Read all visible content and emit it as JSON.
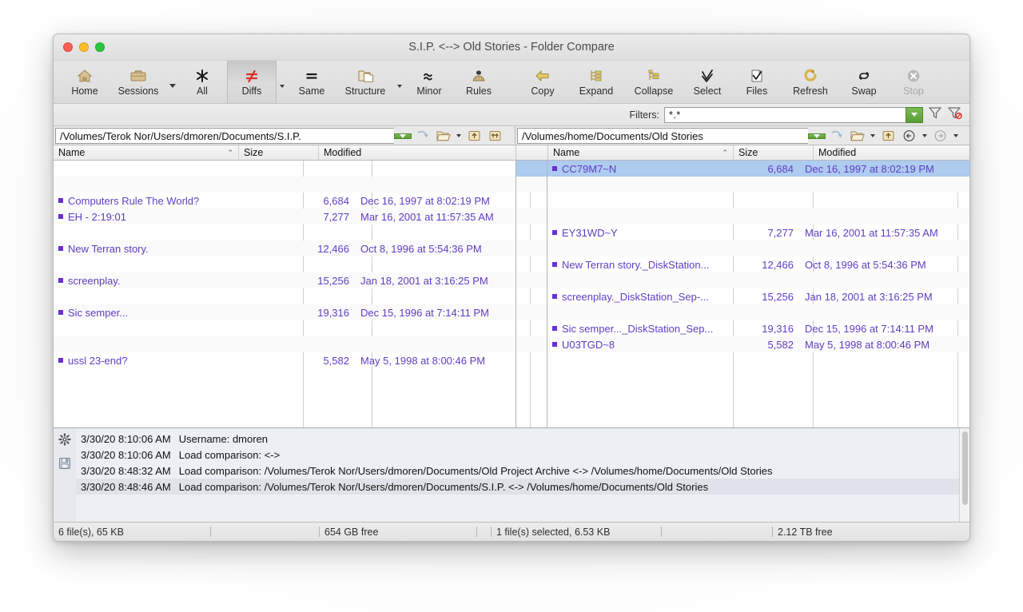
{
  "window": {
    "title": "S.I.P. <--> Old Stories - Folder Compare",
    "traffic": {
      "close": "close-button",
      "minimize": "minimize-button",
      "zoom": "zoom-button"
    }
  },
  "toolbar": {
    "buttons": [
      {
        "label": "Home",
        "icon": "home-icon",
        "state": "normal",
        "caret": false
      },
      {
        "label": "Sessions",
        "icon": "briefcase-icon",
        "state": "normal",
        "caret": true
      },
      {
        "label": "All",
        "icon": "asterisk-icon",
        "state": "normal",
        "caret": false
      },
      {
        "label": "Diffs",
        "icon": "not-equal-icon",
        "state": "active",
        "caret": true
      },
      {
        "label": "Same",
        "icon": "equals-icon",
        "state": "normal",
        "caret": false
      },
      {
        "label": "Structure",
        "icon": "folders-icon",
        "state": "active",
        "caret": true
      },
      {
        "label": "Minor",
        "icon": "approx-icon",
        "state": "normal",
        "caret": false
      },
      {
        "label": "Rules",
        "icon": "rules-icon",
        "state": "normal",
        "caret": false
      },
      {
        "label": "Copy",
        "icon": "arrow-left-icon",
        "state": "normal",
        "caret": false
      },
      {
        "label": "Expand",
        "icon": "expand-icon",
        "state": "normal",
        "caret": false
      },
      {
        "label": "Collapse",
        "icon": "collapse-icon",
        "state": "normal",
        "caret": false
      },
      {
        "label": "Select",
        "icon": "checkmarks-icon",
        "state": "normal",
        "caret": false
      },
      {
        "label": "Files",
        "icon": "file-check-icon",
        "state": "normal",
        "caret": false
      },
      {
        "label": "Refresh",
        "icon": "refresh-icon",
        "state": "normal",
        "caret": false
      },
      {
        "label": "Swap",
        "icon": "swap-icon",
        "state": "normal",
        "caret": false
      },
      {
        "label": "Stop",
        "icon": "stop-icon",
        "state": "disabled",
        "caret": false
      }
    ]
  },
  "filterbar": {
    "label": "Filters:",
    "value": "*.*",
    "placeholder": "",
    "dropdown": "chevron-down-icon",
    "funnel": "filter-icon",
    "funnel_clear": "filter-clear-icon"
  },
  "left_pane": {
    "path": "/Volumes/Terok Nor/Users/dmoren/Documents/S.I.P.",
    "columns": [
      "Name",
      "Size",
      "Modified"
    ],
    "sort_indicator": "⌃",
    "rows": [
      {
        "name": "",
        "size": "",
        "modified": "",
        "blank": true,
        "selected": false
      },
      {
        "name": "",
        "size": "",
        "modified": "",
        "blank": true,
        "selected": false
      },
      {
        "name": "Computers Rule The World?",
        "size": "6,684",
        "modified": "Dec 16, 1997 at 8:02:19 PM",
        "blank": false,
        "selected": false
      },
      {
        "name": "EH - 2:19:01",
        "size": "7,277",
        "modified": "Mar 16, 2001 at 11:57:35 AM",
        "blank": false,
        "selected": false
      },
      {
        "name": "",
        "size": "",
        "modified": "",
        "blank": true,
        "selected": false
      },
      {
        "name": "New Terran story.",
        "size": "12,466",
        "modified": "Oct 8, 1996 at 5:54:36 PM",
        "blank": false,
        "selected": false
      },
      {
        "name": "",
        "size": "",
        "modified": "",
        "blank": true,
        "selected": false
      },
      {
        "name": "screenplay.",
        "size": "15,256",
        "modified": "Jan 18, 2001 at 3:16:25 PM",
        "blank": false,
        "selected": false
      },
      {
        "name": "",
        "size": "",
        "modified": "",
        "blank": true,
        "selected": false
      },
      {
        "name": "Sic semper...",
        "size": "19,316",
        "modified": "Dec 15, 1996 at 7:14:11 PM",
        "blank": false,
        "selected": false
      },
      {
        "name": "",
        "size": "",
        "modified": "",
        "blank": true,
        "selected": false
      },
      {
        "name": "",
        "size": "",
        "modified": "",
        "blank": true,
        "selected": false
      },
      {
        "name": "ussl 23-end?",
        "size": "5,582",
        "modified": "May 5, 1998 at 8:00:46 PM",
        "blank": false,
        "selected": false
      }
    ]
  },
  "right_pane": {
    "path": "/Volumes/home/Documents/Old Stories",
    "columns": [
      "Name",
      "Size",
      "Modified"
    ],
    "sort_indicator": "⌃",
    "rows": [
      {
        "name": "CC79M7~N",
        "size": "6,684",
        "modified": "Dec 16, 1997 at 8:02:19 PM",
        "blank": false,
        "selected": true
      },
      {
        "name": "",
        "size": "",
        "modified": "",
        "blank": true,
        "selected": false
      },
      {
        "name": "",
        "size": "",
        "modified": "",
        "blank": true,
        "selected": false
      },
      {
        "name": "",
        "size": "",
        "modified": "",
        "blank": true,
        "selected": false
      },
      {
        "name": "EY31WD~Y",
        "size": "7,277",
        "modified": "Mar 16, 2001 at 11:57:35 AM",
        "blank": false,
        "selected": false
      },
      {
        "name": "",
        "size": "",
        "modified": "",
        "blank": true,
        "selected": false
      },
      {
        "name": "New Terran story._DiskStation...",
        "size": "12,466",
        "modified": "Oct 8, 1996 at 5:54:36 PM",
        "blank": false,
        "selected": false
      },
      {
        "name": "",
        "size": "",
        "modified": "",
        "blank": true,
        "selected": false
      },
      {
        "name": "screenplay._DiskStation_Sep-...",
        "size": "15,256",
        "modified": "Jan 18, 2001 at 3:16:25 PM",
        "blank": false,
        "selected": false
      },
      {
        "name": "",
        "size": "",
        "modified": "",
        "blank": true,
        "selected": false
      },
      {
        "name": "Sic semper..._DiskStation_Sep...",
        "size": "19,316",
        "modified": "Dec 15, 1996 at 7:14:11 PM",
        "blank": false,
        "selected": false
      },
      {
        "name": "U03TGD~8",
        "size": "5,582",
        "modified": "May 5, 1998 at 8:00:46 PM",
        "blank": false,
        "selected": false
      }
    ]
  },
  "log": {
    "gutter_icons": [
      "gear-icon",
      "save-icon"
    ],
    "lines": [
      {
        "timestamp": "3/30/20 8:10:06 AM",
        "message": "Username: dmoren",
        "highlight": false
      },
      {
        "timestamp": "3/30/20 8:10:06 AM",
        "message": "Load comparison:  <->",
        "highlight": false
      },
      {
        "timestamp": "3/30/20 8:48:32 AM",
        "message": "Load comparison: /Volumes/Terok Nor/Users/dmoren/Documents/Old Project Archive <-> /Volumes/home/Documents/Old Stories",
        "highlight": false
      },
      {
        "timestamp": "3/30/20 8:48:46 AM",
        "message": "Load comparison: /Volumes/Terok Nor/Users/dmoren/Documents/S.I.P. <-> /Volumes/home/Documents/Old Stories",
        "highlight": true
      }
    ]
  },
  "statusbar": {
    "file_count": "6 file(s), 65 KB",
    "left_free": "654 GB free",
    "selection": "1 file(s) selected, 6.53 KB",
    "right_free": "2.12 TB free"
  },
  "colors": {
    "accent_purple": "#5f3dc4",
    "selection_blue": "#aecbf0",
    "green_button": "#5b9e36",
    "diff_red": "#d93025"
  }
}
